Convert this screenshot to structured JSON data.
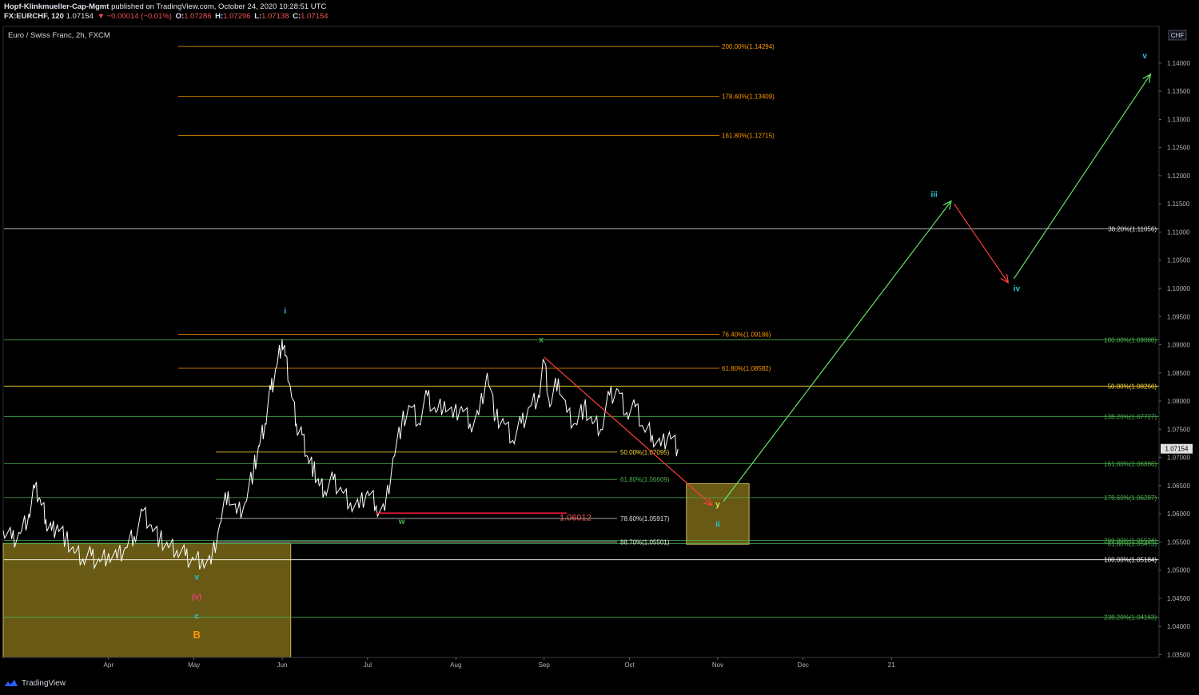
{
  "header": {
    "publisher": "Hopf-Klinkmueller-Cap-Mgmt",
    "published_text": "published on TradingView.com, October 24, 2020 10:28:51 UTC",
    "symbol": "FX:EURCHF, 120",
    "last": "1.07154",
    "change": "▼ −0.00014 (−0.01%)",
    "o_label": "O:",
    "o": "1.07286",
    "h_label": "H:",
    "h": "1.07296",
    "l_label": "L:",
    "l": "1.07138",
    "c_label": "C:",
    "c": "1.07154"
  },
  "chart_title": "Euro / Swiss Franc, 2h, FXCM",
  "footer": {
    "brand": "TradingView"
  },
  "chart_data": {
    "type": "line",
    "currency": "CHF",
    "y_range": [
      1.0345,
      1.1465
    ],
    "y_ticks": [
      "1.14000",
      "1.13500",
      "1.13000",
      "1.12500",
      "1.12000",
      "1.11500",
      "1.11000",
      "1.10500",
      "1.10000",
      "1.09500",
      "1.09000",
      "1.08500",
      "1.08000",
      "1.07500",
      "1.07000",
      "1.06500",
      "1.06000",
      "1.05500",
      "1.05000",
      "1.04500",
      "1.04000",
      "1.03500"
    ],
    "y_tick_values": [
      1.14,
      1.135,
      1.13,
      1.125,
      1.12,
      1.115,
      1.11,
      1.105,
      1.1,
      1.095,
      1.09,
      1.085,
      1.08,
      1.075,
      1.07,
      1.065,
      1.06,
      1.055,
      1.05,
      1.045,
      1.04,
      1.035
    ],
    "x_ticks": [
      "Apr",
      "May",
      "Jun",
      "Jul",
      "Aug",
      "Sep",
      "Oct",
      "Nov",
      "Dec",
      "21"
    ],
    "x_tick_days": [
      31,
      61,
      92,
      122,
      153,
      184,
      214,
      245,
      275,
      306
    ],
    "x_range_days": [
      -6,
      400
    ],
    "last_price_label": "1.07154",
    "price_series_days": [
      -6,
      -3,
      0,
      3,
      5,
      7,
      9,
      11,
      13,
      16,
      19,
      22,
      25,
      28,
      31,
      34,
      37,
      40,
      43,
      46,
      49,
      52,
      55,
      58,
      61,
      64,
      67,
      70,
      73,
      76,
      79,
      82,
      84,
      86,
      88,
      90,
      92,
      93,
      95,
      97,
      99,
      101,
      103,
      105,
      107,
      110,
      113,
      116,
      119,
      122,
      125,
      128,
      131,
      134,
      137,
      140,
      143,
      146,
      149,
      152,
      155,
      158,
      161,
      164,
      167,
      170,
      173,
      176,
      179,
      182,
      184,
      186,
      189,
      192,
      195,
      198,
      201,
      204,
      207,
      210,
      213,
      216,
      219,
      222,
      225,
      228,
      231
    ],
    "price_series_values": [
      1.057,
      1.0555,
      1.0565,
      1.06,
      1.0645,
      1.0625,
      1.059,
      1.057,
      1.058,
      1.0555,
      1.053,
      1.052,
      1.0525,
      1.0515,
      1.053,
      1.052,
      1.054,
      1.056,
      1.0605,
      1.058,
      1.0555,
      1.054,
      1.0535,
      1.0525,
      1.0518,
      1.052,
      1.051,
      1.058,
      1.064,
      1.06,
      1.062,
      1.068,
      1.072,
      1.076,
      1.082,
      1.086,
      1.091,
      1.088,
      1.082,
      1.076,
      1.074,
      1.07,
      1.068,
      1.065,
      1.064,
      1.066,
      1.064,
      1.062,
      1.061,
      1.064,
      1.0615,
      1.0605,
      1.07,
      1.076,
      1.079,
      1.076,
      1.081,
      1.078,
      1.08,
      1.077,
      1.079,
      1.076,
      1.0775,
      1.085,
      1.077,
      1.076,
      1.073,
      1.076,
      1.079,
      1.081,
      1.087,
      1.079,
      1.084,
      1.078,
      1.076,
      1.079,
      1.076,
      1.075,
      1.081,
      1.082,
      1.078,
      1.079,
      1.075,
      1.074,
      1.072,
      1.0745,
      1.0715
    ],
    "annotations": [
      {
        "label": "i",
        "color": "#26c6da",
        "day": 93,
        "price": 1.0955
      },
      {
        "label": "x",
        "color": "#4caf50",
        "day": 183,
        "price": 1.0904
      },
      {
        "label": "w",
        "color": "#4caf50",
        "day": 134,
        "price": 1.0582
      },
      {
        "label": "y",
        "color": "#d4e157",
        "day": 245,
        "price": 1.0612
      },
      {
        "label": "ii",
        "color": "#26c6da",
        "day": 245,
        "price": 1.0577
      },
      {
        "label": "iii",
        "color": "#26c6da",
        "day": 321,
        "price": 1.1162
      },
      {
        "label": "iv",
        "color": "#26c6da",
        "day": 350,
        "price": 1.0995
      },
      {
        "label": "v",
        "color": "#26c6da",
        "day": 395,
        "price": 1.1408
      },
      {
        "label": "v",
        "color": "#26c6da",
        "day": 62,
        "price": 1.0483
      },
      {
        "label": "(v)",
        "color": "#ec407a",
        "day": 62,
        "price": 1.0448
      },
      {
        "label": "c",
        "color": "#26c6da",
        "day": 62,
        "price": 1.0414
      },
      {
        "label": "B",
        "color": "#ff9800",
        "day": 62,
        "price": 1.0379
      },
      {
        "label": "1.06012",
        "color": "#ef5350",
        "day": 195,
        "price": 1.0588
      }
    ],
    "fib_levels": [
      {
        "label": "200.00%(1.14294)",
        "price": 1.14294,
        "color": "#ff9800",
        "x0": 223,
        "x1": 900,
        "label_x": 903,
        "align": "start"
      },
      {
        "label": "178.60%(1.13409)",
        "price": 1.13409,
        "color": "#ff9800",
        "x0": 223,
        "x1": 900,
        "label_x": 903,
        "align": "start"
      },
      {
        "label": "161.80%(1.12715)",
        "price": 1.12715,
        "color": "#ff9800",
        "x0": 223,
        "x1": 900,
        "label_x": 903,
        "align": "start"
      },
      {
        "label": "76.40%(1.09186)",
        "price": 1.09186,
        "color": "#ff9800",
        "x0": 223,
        "x1": 900,
        "label_x": 903,
        "align": "start"
      },
      {
        "label": "61.80%(1.08582)",
        "price": 1.08582,
        "color": "#ff9800",
        "x0": 223,
        "x1": 900,
        "label_x": 903,
        "align": "start"
      },
      {
        "label": "38.20%(1.11056)",
        "price": 1.11056,
        "color": "#e0e0e0",
        "x0": 5,
        "x1": 1450,
        "label_x": 1447,
        "align": "end"
      },
      {
        "label": "100.00%(1.09088)",
        "price": 1.09088,
        "color": "#4caf50",
        "x0": 5,
        "x1": 1450,
        "label_x": 1447,
        "align": "end"
      },
      {
        "label": "50.00%(1.08266)",
        "price": 1.08266,
        "color": "#fdd835",
        "x0": 5,
        "x1": 1450,
        "label_x": 1447,
        "align": "end"
      },
      {
        "label": "138.20%(1.07727)",
        "price": 1.07727,
        "color": "#4caf50",
        "x0": 5,
        "x1": 1450,
        "label_x": 1447,
        "align": "end"
      },
      {
        "label": "50.00%(1.07095)",
        "price": 1.07095,
        "color": "#fdd835",
        "x0": 270,
        "x1": 772,
        "label_x": 776,
        "align": "start"
      },
      {
        "label": "161.80%(1.06886)",
        "price": 1.06886,
        "color": "#4caf50",
        "x0": 5,
        "x1": 1450,
        "label_x": 1447,
        "align": "end"
      },
      {
        "label": "61.80%(1.06609)",
        "price": 1.06609,
        "color": "#4caf50",
        "x0": 270,
        "x1": 772,
        "label_x": 776,
        "align": "start"
      },
      {
        "label": "178.60%(1.06287)",
        "price": 1.06287,
        "color": "#4caf50",
        "x0": 5,
        "x1": 1450,
        "label_x": 1447,
        "align": "end"
      },
      {
        "label": "78.60%(1.05917)",
        "price": 1.05917,
        "color": "#e0e0e0",
        "x0": 270,
        "x1": 772,
        "label_x": 776,
        "align": "start"
      },
      {
        "label": "200.00%(1.05524)",
        "price": 1.05524,
        "color": "#4caf50",
        "x0": 5,
        "x1": 1450,
        "label_x": 1447,
        "align": "end"
      },
      {
        "label": "61.80%(1.05473)",
        "price": 1.05473,
        "color": "#4caf50",
        "x0": 5,
        "x1": 1450,
        "label_x": 1447,
        "align": "end"
      },
      {
        "label": "88.70%(1.05501)",
        "price": 1.05501,
        "color": "#e0e0e0",
        "x0": 270,
        "x1": 772,
        "label_x": 776,
        "align": "start"
      },
      {
        "label": "100.00%(1.05184)",
        "price": 1.05184,
        "color": "#ffffff",
        "x0": 5,
        "x1": 1450,
        "label_x": 1447,
        "align": "end"
      },
      {
        "label": "238.20%(1.04163)",
        "price": 1.04163,
        "color": "#4caf50",
        "x0": 5,
        "x1": 1450,
        "label_x": 1447,
        "align": "end"
      }
    ],
    "support_line": {
      "price": 1.06012,
      "day_start": 125,
      "day_end": 192,
      "color": "#ff1744"
    },
    "zones": [
      {
        "day_start": -6,
        "day_end": 95,
        "price_top": 1.05473,
        "price_bottom": 1.0345,
        "color": "#7a6a18"
      },
      {
        "day_start": 234,
        "day_end": 256,
        "price_top": 1.06535,
        "price_bottom": 1.0546,
        "color": "#7a6a18"
      }
    ],
    "arrows": [
      {
        "from_day": 184,
        "from_price": 1.0878,
        "to_day": 243,
        "to_price": 1.0615,
        "color": "#ff3d3d"
      },
      {
        "from_day": 247,
        "from_price": 1.0622,
        "to_day": 327,
        "to_price": 1.1155,
        "color": "#66e36a"
      },
      {
        "from_day": 328,
        "from_price": 1.115,
        "to_day": 347,
        "to_price": 1.101,
        "color": "#ff3d3d"
      },
      {
        "from_day": 349,
        "from_price": 1.1017,
        "to_day": 397,
        "to_price": 1.138,
        "color": "#66e36a"
      }
    ]
  }
}
